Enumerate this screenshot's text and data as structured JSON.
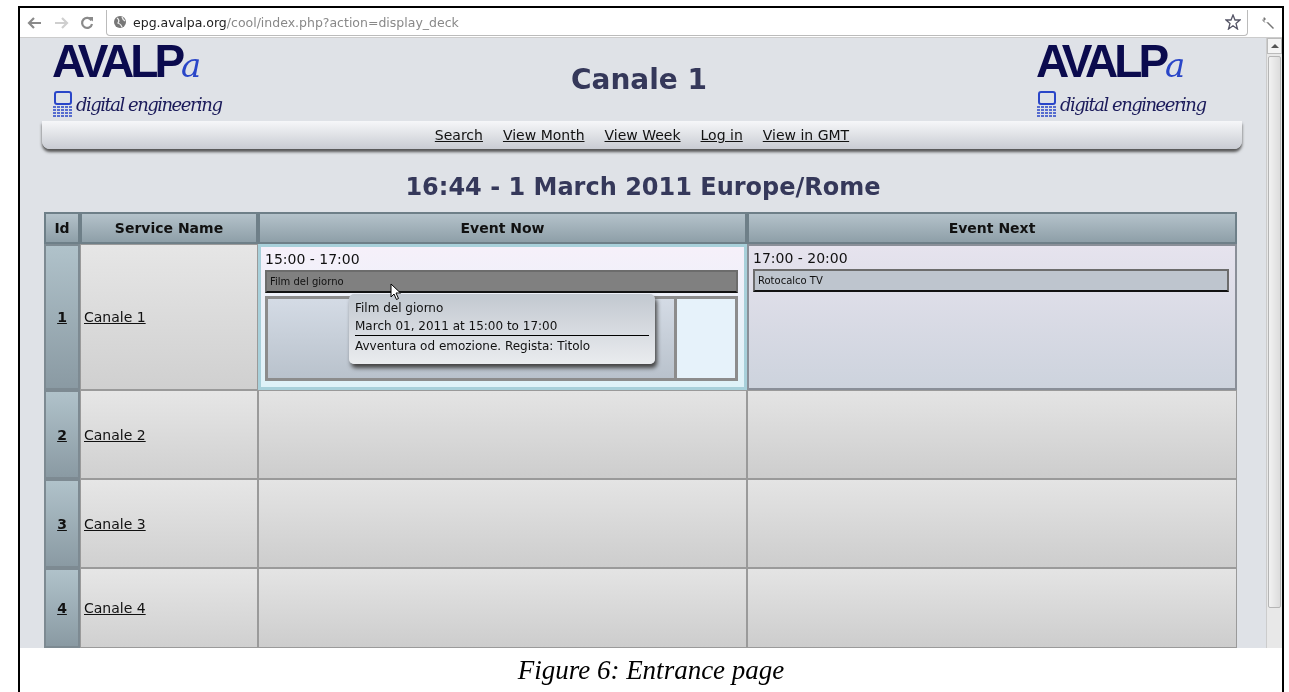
{
  "browser": {
    "url_host": "epg.avalpa.org",
    "url_path": "/cool/index.php?action=display_deck"
  },
  "header": {
    "title": "Canale 1",
    "logos": [
      {
        "main": "AVALP",
        "accent": "a",
        "tagline": "digital engineering"
      },
      {
        "main": "AVALP",
        "accent": "a",
        "tagline": "digital engineering"
      }
    ]
  },
  "nav": [
    "Search",
    "View Month",
    "View Week",
    "Log in",
    "View in GMT"
  ],
  "heading": "16:44 - 1 March 2011 Europe/Rome",
  "table": {
    "columns": [
      "Id",
      "Service Name",
      "Event Now",
      "Event Next"
    ],
    "rows": [
      {
        "id": "1",
        "name": "Canale 1",
        "now": {
          "time": "15:00 - 17:00",
          "title": "Film del giorno",
          "hovered": true,
          "progress": {
            "level": 0.87
          }
        },
        "next": {
          "time": "17:00 - 20:00",
          "title": "Rotocalco TV",
          "hovered": false
        }
      },
      {
        "id": "2",
        "name": "Canale 2"
      },
      {
        "id": "3",
        "name": "Canale 3"
      },
      {
        "id": "4",
        "name": "Canale 4"
      }
    ]
  },
  "tooltip": {
    "title": "Film del giorno",
    "date": "March 01, 2011 at 15:00 to 17:00",
    "description": "Avventura od emozione. Regista: Titolo"
  },
  "caption": "Figure 6: Entrance page"
}
